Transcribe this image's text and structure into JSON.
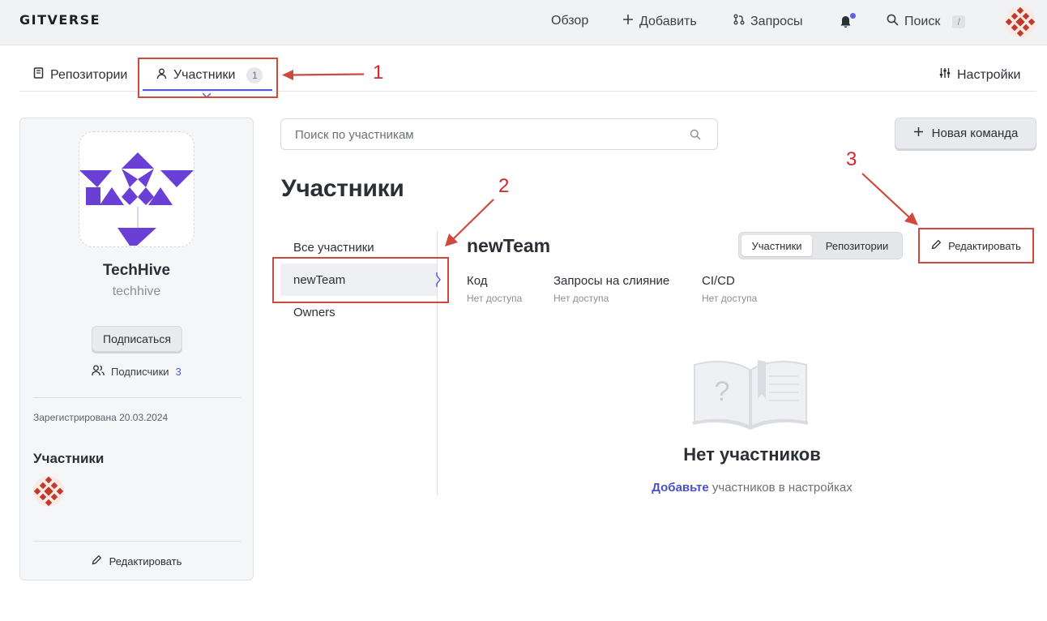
{
  "header": {
    "logo": "GITVERSE",
    "nav": {
      "overview": "Обзор",
      "add": "Добавить",
      "requests": "Запросы",
      "search": "Поиск",
      "search_shortcut": "/"
    }
  },
  "tabs": {
    "repositories": "Репозитории",
    "members": "Участники",
    "members_count": "1",
    "settings": "Настройки"
  },
  "org": {
    "name": "TechHive",
    "login": "techhive",
    "subscribe_label": "Подписаться",
    "followers_label": "Подписчики",
    "followers_count": "3",
    "registered": "Зарегистрирована 20.03.2024",
    "members_title": "Участники",
    "edit_label": "Редактировать"
  },
  "main": {
    "search_placeholder": "Поиск по участникам",
    "new_team_label": "Новая команда",
    "page_title": "Участники",
    "team_list": [
      "Все участники",
      "newTeam",
      "Owners"
    ],
    "selected_team": "newTeam",
    "segments": [
      "Участники",
      "Репозитории"
    ],
    "edit_label": "Редактировать",
    "permissions": [
      {
        "label": "Код",
        "value": "Нет доступа"
      },
      {
        "label": "Запросы на слияние",
        "value": "Нет доступа"
      },
      {
        "label": "CI/CD",
        "value": "Нет доступа"
      }
    ],
    "empty_title": "Нет участников",
    "empty_link": "Добавьте",
    "empty_text": " участников в настройках"
  },
  "annotations": {
    "n1": "1",
    "n2": "2",
    "n3": "3",
    "color": "#cf4a3e"
  },
  "colors": {
    "accent": "#5458d9",
    "brand_purple": "#6a3fd6",
    "avatar_red": "#c0392b"
  }
}
